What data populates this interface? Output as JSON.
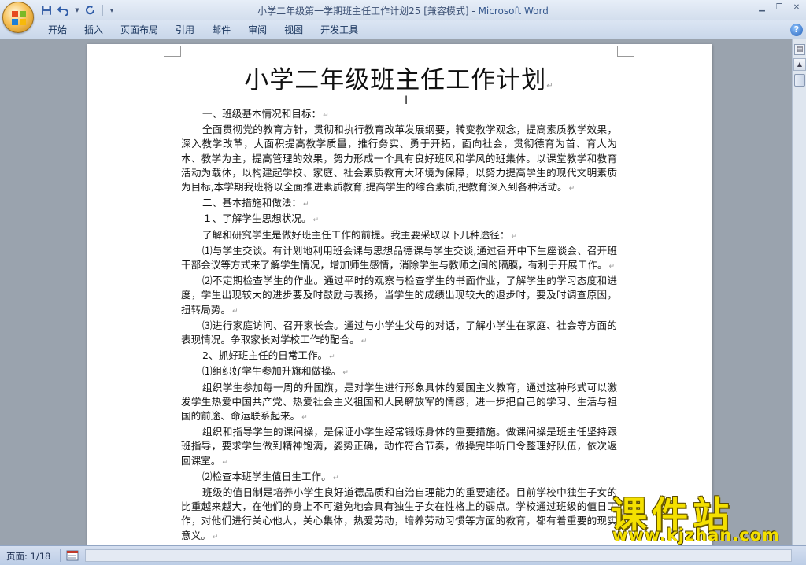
{
  "window": {
    "title": "小学二年级第一学期班主任工作计划25 [兼容模式] - ",
    "brand": "Microsoft Word"
  },
  "ribbon": {
    "tabs": [
      {
        "label": "开始"
      },
      {
        "label": "插入"
      },
      {
        "label": "页面布局"
      },
      {
        "label": "引用"
      },
      {
        "label": "邮件"
      },
      {
        "label": "审阅"
      },
      {
        "label": "视图"
      },
      {
        "label": "开发工具"
      }
    ]
  },
  "document": {
    "title": "小学二年级班主任工作计划",
    "paragraphs": [
      "一、班级基本情况和目标：",
      "全面贯彻党的教育方针，贯彻和执行教育改革发展纲要，转变教学观念，提高素质教学效果，深入教学改革，大面积提高教学质量，推行务实、勇于开拓，面向社会，贯彻德育为首、育人为本、教学为主，提高管理的效果，努力形成一个具有良好班风和学风的班集体。以课堂教学和教育活动为载体，以构建起学校、家庭、社会素质教育大环境为保障，以努力提高学生的现代文明素质为目标,本学期我班将以全面推进素质教育,提高学生的综合素质,把教育深入到各种活动。",
      "二、基本措施和做法：",
      "１、了解学生思想状况。",
      "了解和研究学生是做好班主任工作的前提。我主要采取以下几种途径：",
      "⑴与学生交谈。有计划地利用班会课与思想品德课与学生交谈,通过召开中下生座谈会、召开班干部会议等方式来了解学生情况，增加师生感情，消除学生与教师之间的隔膜，有利于开展工作。",
      "⑵不定期检查学生的作业。通过平时的观察与检查学生的书面作业，了解学生的学习态度和进度，学生出现较大的进步要及时鼓励与表扬，当学生的成绩出现较大的退步时，要及时调查原因，扭转局势。",
      "⑶进行家庭访问、召开家长会。通过与小学生父母的对话，了解小学生在家庭、社会等方面的表现情况。争取家长对学校工作的配合。",
      "2、抓好班主任的日常工作。",
      "⑴组织好学生参加升旗和做操。",
      "组织学生参加每一周的升国旗，是对学生进行形象具体的爱国主义教育，通过这种形式可以激发学生热爱中国共产党、热爱社会主义祖国和人民解放军的情感，进一步把自己的学习、生活与祖国的前途、命运联系起来。",
      "组织和指导学生的课间操，是保证小学生经常锻炼身体的重要措施。做课间操是班主任坚持跟班指导，要求学生做到精神饱满，姿势正确，动作符合节奏，做操完毕听口令整理好队伍，依次返回课室。",
      "⑵检查本班学生值日生工作。",
      "班级的值日制是培养小学生良好道德品质和自治自理能力的重要途径。目前学校中独生子女的比重越来越大，在他们的身上不可避免地会具有独生子女在性格上的弱点。学校通过班级的值日工作，对他们进行关心他人，关心集体，热爱劳动，培养劳动习惯等方面的教育，都有着重要的现实意义。"
    ]
  },
  "watermark": {
    "text": "课件站",
    "url": "www.kjzhan.com"
  },
  "status": {
    "page_label": "页面: 1/18"
  },
  "colors": {
    "title_text": "#3e5275",
    "brand_text": "#385a8f",
    "watermark_yellow": "#f4e000"
  },
  "icons": [
    "office-button-icon",
    "save-icon",
    "undo-icon",
    "redo-icon",
    "customize-qat-icon",
    "minimize-icon",
    "restore-icon",
    "close-icon",
    "help-icon",
    "view-ruler-icon",
    "scroll-up-icon",
    "document-view-icon"
  ]
}
